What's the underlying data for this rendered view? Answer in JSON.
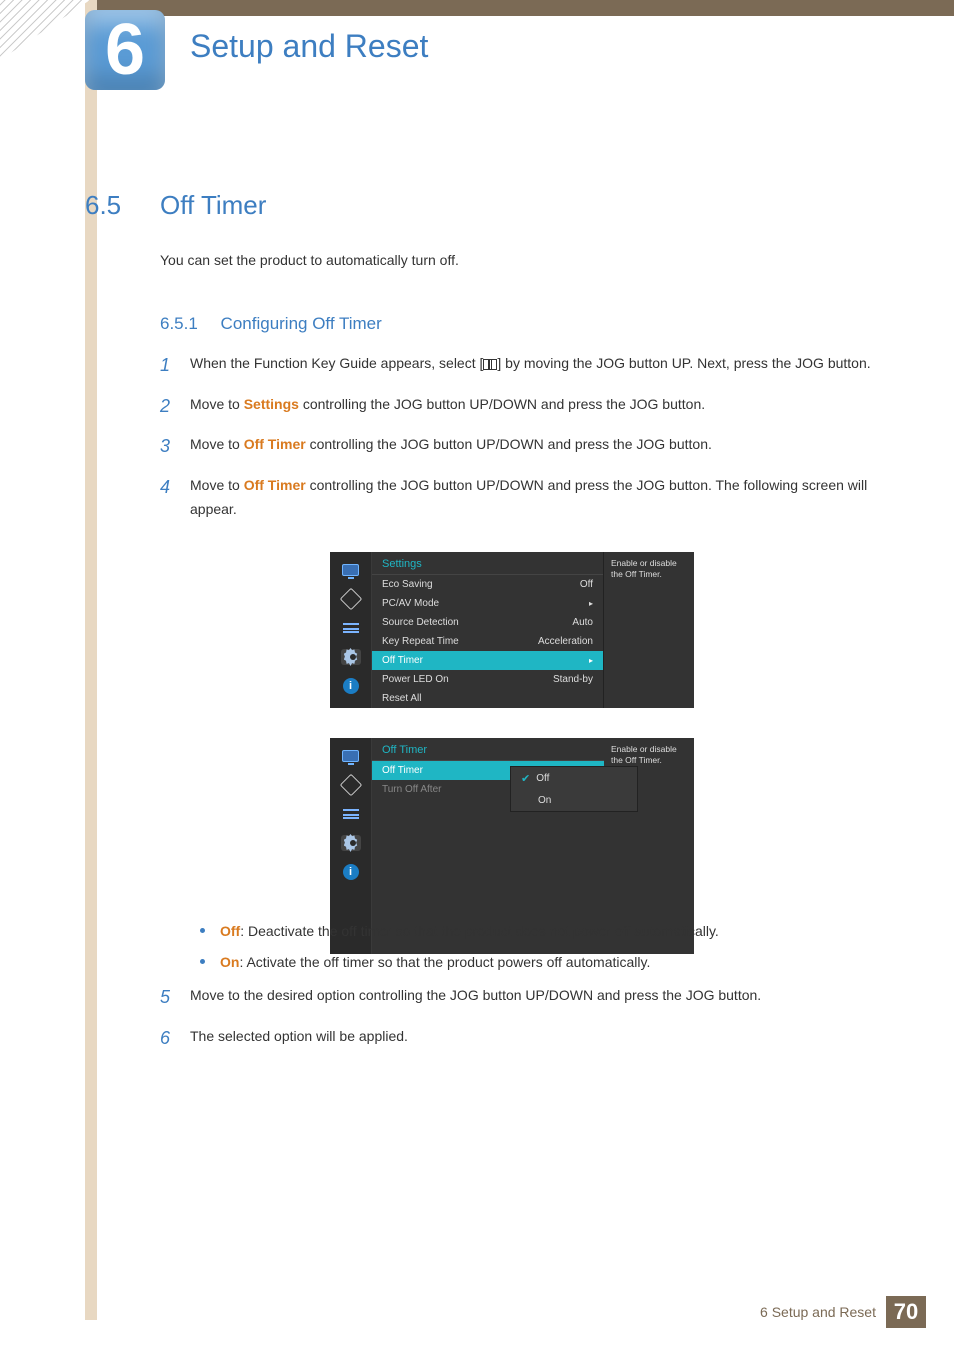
{
  "chapter": {
    "num": "6",
    "title": "Setup and Reset"
  },
  "section": {
    "num": "6.5",
    "title": "Off Timer"
  },
  "intro": "You can set the product to automatically turn off.",
  "subsection": {
    "num": "6.5.1",
    "title": "Configuring Off Timer"
  },
  "steps": {
    "s1": {
      "num": "1",
      "pre": "When the Function Key Guide appears, select [",
      "post": "] by moving the JOG button UP. Next, press the JOG button."
    },
    "s2": {
      "num": "2",
      "pre": "Move to ",
      "bold": "Settings",
      "post": " controlling the JOG button UP/DOWN and press the JOG button."
    },
    "s3": {
      "num": "3",
      "pre": "Move to ",
      "bold": "Off Timer",
      "post": " controlling the JOG button UP/DOWN and press the JOG button."
    },
    "s4": {
      "num": "4",
      "pre": "Move to ",
      "bold": "Off Timer",
      "post": " controlling the JOG button UP/DOWN and press the JOG button. The following screen will appear."
    },
    "s5": {
      "num": "5",
      "text": "Move to the desired option controlling the JOG button UP/DOWN and press the JOG button."
    },
    "s6": {
      "num": "6",
      "text": "The selected option will be applied."
    }
  },
  "osd1": {
    "title": "Settings",
    "rows": [
      {
        "label": "Eco Saving",
        "value": "Off"
      },
      {
        "label": "PC/AV Mode",
        "value": "▸"
      },
      {
        "label": "Source Detection",
        "value": "Auto"
      },
      {
        "label": "Key Repeat Time",
        "value": "Acceleration"
      },
      {
        "label": "Off Timer",
        "value": "▸"
      },
      {
        "label": "Power LED On",
        "value": "Stand-by"
      },
      {
        "label": "Reset All",
        "value": ""
      }
    ],
    "help": "Enable or disable the Off Timer."
  },
  "osd2": {
    "title": "Off Timer",
    "rows": [
      {
        "label": "Off Timer"
      },
      {
        "label": "Turn Off After"
      }
    ],
    "popup": {
      "opt1": "Off",
      "opt2": "On"
    },
    "help": "Enable or disable the Off Timer."
  },
  "bullets": {
    "b1": {
      "bold": "Off",
      "text": ": Deactivate the off timer so that the product does not power off automatically."
    },
    "b2": {
      "bold": "On",
      "text": ": Activate the off timer so that the product powers off automatically."
    }
  },
  "footer": {
    "text": "6 Setup and Reset",
    "page": "70"
  }
}
